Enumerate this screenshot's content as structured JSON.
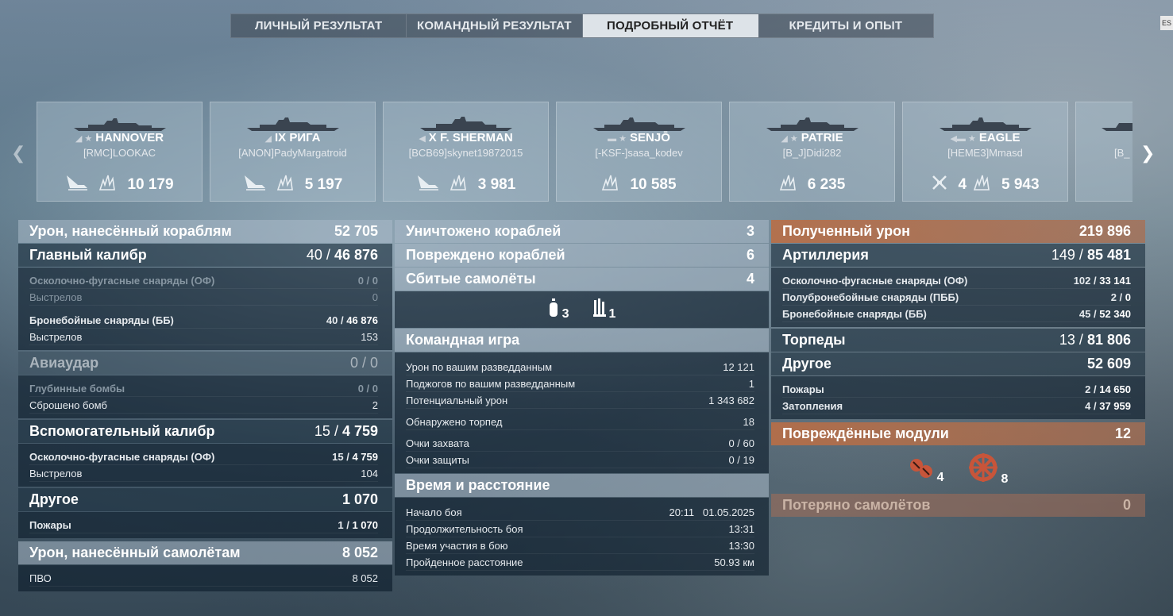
{
  "tabs": [
    {
      "label": "ЛИЧНЫЙ РЕЗУЛЬТАТ"
    },
    {
      "label": "КОМАНДНЫЙ РЕЗУЛЬТАТ"
    },
    {
      "label": "ПОДРОБНЫЙ ОТЧЁТ"
    },
    {
      "label": "КРЕДИТЫ И ОПЫТ"
    }
  ],
  "active_tab": 2,
  "esc_label": "ES",
  "ships": [
    {
      "level": "",
      "name": "HANNOVER",
      "player": "[RMC]LOOKAC",
      "ribbon": "10 179",
      "destroyed": ""
    },
    {
      "level": "IX",
      "name": "РИГА",
      "player": "[ANON]PadyMargatroid",
      "ribbon": "5 197",
      "destroyed": ""
    },
    {
      "level": "X",
      "name": "F. SHERMAN",
      "player": "[BCB69]skynet19872015",
      "ribbon": "3 981",
      "destroyed": ""
    },
    {
      "level": "",
      "name": "SENJŌ",
      "player": "[-KSF-]sasa_kodev",
      "ribbon": "10 585",
      "destroyed": ""
    },
    {
      "level": "",
      "name": "PATRIE",
      "player": "[B_J]Didi282",
      "ribbon": "6 235",
      "destroyed": ""
    },
    {
      "level": "",
      "name": "EAGLE",
      "player": "[HEME3]Mmasd",
      "ribbon": "5 943",
      "destroyed": "4"
    },
    {
      "level": "",
      "name": "",
      "player": "[B_",
      "ribbon": "",
      "destroyed": ""
    }
  ],
  "left": {
    "damage_ships": {
      "label": "Урон, нанесённый кораблям",
      "value": "52 705"
    },
    "main_battery": {
      "label": "Главный калибр",
      "hits": "40",
      "dmg": "46 876"
    },
    "he_shells": {
      "label": "Осколочно-фугасные снаряды (ОФ)",
      "value": "0 / 0"
    },
    "he_shots": {
      "label": "Выстрелов",
      "value": "0"
    },
    "ap_shells": {
      "label": "Бронебойные снаряды (ББ)",
      "hits": "40",
      "dmg": "46 876"
    },
    "ap_shots": {
      "label": "Выстрелов",
      "value": "153"
    },
    "airstrike": {
      "label": "Авиаудар",
      "value": "0 / 0"
    },
    "depth_charges": {
      "label": "Глубинные бомбы",
      "value": "0 / 0"
    },
    "bombs_dropped": {
      "label": "Сброшено бомб",
      "value": "2"
    },
    "secondary": {
      "label": "Вспомогательный калибр",
      "hits": "15",
      "dmg": "4 759"
    },
    "sec_he": {
      "label": "Осколочно-фугасные снаряды (ОФ)",
      "hits": "15",
      "dmg": "4 759"
    },
    "sec_shots": {
      "label": "Выстрелов",
      "value": "104"
    },
    "other": {
      "label": "Другое",
      "value": "1 070"
    },
    "fires": {
      "label": "Пожары",
      "hits": "1",
      "dmg": "1 070"
    },
    "damage_planes": {
      "label": "Урон, нанесённый самолётам",
      "value": "8 052"
    },
    "aa": {
      "label": "ПВО",
      "value": "8 052"
    }
  },
  "middle": {
    "destroyed": {
      "label": "Уничтожено кораблей",
      "value": "3"
    },
    "damaged": {
      "label": "Повреждено кораблей",
      "value": "6"
    },
    "planes_shot": {
      "label": "Сбитые самолёты",
      "value": "4"
    },
    "plane_icons": [
      {
        "icon": "fighter-icon",
        "value": "3"
      },
      {
        "icon": "aa-gun-icon",
        "value": "1"
      }
    ],
    "team": {
      "label": "Командная игра"
    },
    "spotting_damage": {
      "label": "Урон по вашим разведданным",
      "value": "12 121"
    },
    "spotting_fires": {
      "label": "Поджогов по вашим разведданным",
      "value": "1"
    },
    "potential": {
      "label": "Потенциальный урон",
      "value": "1 343 682"
    },
    "torpedoes_spotted": {
      "label": "Обнаружено торпед",
      "value": "18"
    },
    "capture": {
      "label": "Очки захвата",
      "value": "0 / 60"
    },
    "defense": {
      "label": "Очки защиты",
      "value": "0 / 19"
    },
    "time": {
      "label": "Время и расстояние"
    },
    "start": {
      "label": "Начало боя",
      "value": "20:11   01.05.2025"
    },
    "duration": {
      "label": "Продолжительность боя",
      "value": "13:31"
    },
    "participation": {
      "label": "Время участия в бою",
      "value": "13:30"
    },
    "distance": {
      "label": "Пройденное расстояние",
      "value": "50.93 км"
    }
  },
  "right": {
    "received": {
      "label": "Полученный урон",
      "value": "219 896"
    },
    "artillery": {
      "label": "Артиллерия",
      "hits": "149",
      "dmg": "85 481"
    },
    "r_he": {
      "label": "Осколочно-фугасные снаряды (ОФ)",
      "hits": "102",
      "dmg": "33 141"
    },
    "r_sap": {
      "label": "Полубронебойные снаряды (ПББ)",
      "hits": "2",
      "dmg": "0"
    },
    "r_ap": {
      "label": "Бронебойные снаряды (ББ)",
      "hits": "45",
      "dmg": "52 340"
    },
    "torpedoes": {
      "label": "Торпеды",
      "hits": "13",
      "dmg": "81 806"
    },
    "r_other": {
      "label": "Другое",
      "value": "52 609"
    },
    "r_fires": {
      "label": "Пожары",
      "hits": "2",
      "dmg": "14 650"
    },
    "r_flood": {
      "label": "Затопления",
      "hits": "4",
      "dmg": "37 959"
    },
    "modules": {
      "label": "Повреждённые модули",
      "value": "12"
    },
    "module_icons": [
      {
        "icon": "turret-icon",
        "value": "4"
      },
      {
        "icon": "steering-icon",
        "value": "8"
      }
    ],
    "planes_lost": {
      "label": "Потеряно самолётов",
      "value": "0"
    }
  }
}
